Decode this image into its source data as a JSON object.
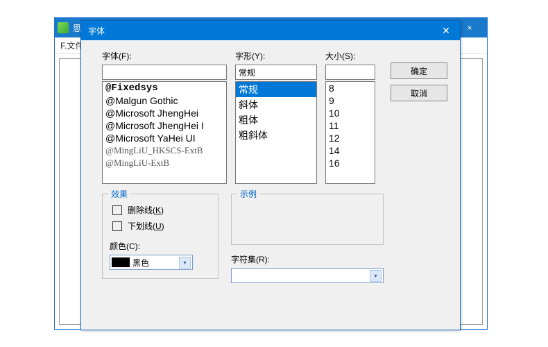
{
  "parent": {
    "title": "思倩",
    "menu_file": "F.文件"
  },
  "dialog": {
    "title": "字体",
    "font_label": "字体(F):",
    "style_label": "字形(Y):",
    "size_label": "大小(S):",
    "font_value": "",
    "style_value": "常规",
    "size_value": "",
    "font_list": [
      "@Fixedsys",
      "@Malgun Gothic",
      "@Microsoft JhengHei",
      "@Microsoft JhengHei I",
      "@Microsoft YaHei UI",
      "@MingLiU_HKSCS-ExtB",
      "@MingLiU-ExtB"
    ],
    "style_list": [
      "常规",
      "斜体",
      "粗体",
      "粗斜体"
    ],
    "style_selected": "常规",
    "size_list": [
      "8",
      "9",
      "10",
      "11",
      "12",
      "14",
      "16"
    ],
    "effects_legend": "效果",
    "sample_legend": "示例",
    "strikeout_label": "删除线(K)",
    "underline_label": "下划线(U)",
    "color_label": "颜色(C):",
    "color_value": "黑色",
    "charset_label": "字符集(R):",
    "charset_value": "",
    "ok": "确定",
    "cancel": "取消"
  }
}
